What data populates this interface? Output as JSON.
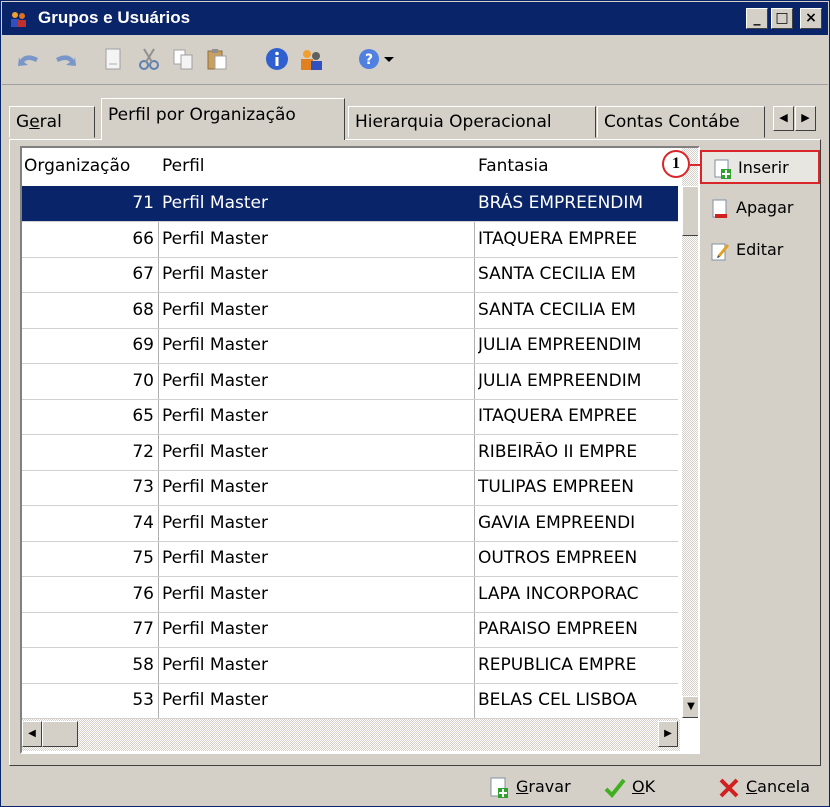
{
  "window": {
    "title": "Grupos e Usuários",
    "controls": {
      "minimize": "_",
      "maximize": "□",
      "close": "×"
    }
  },
  "toolbar": {
    "icons": [
      "undo-icon",
      "redo-icon",
      "new-document-icon",
      "cut-icon",
      "copy-icon",
      "paste-icon",
      "info-icon",
      "user-group-icon",
      "help-icon",
      "dropdown-arrow-icon"
    ]
  },
  "tabs": {
    "items": [
      {
        "label_pre": "G",
        "label_mnemonic": "e",
        "label_post": "ral",
        "active": false
      },
      {
        "label": "Perfil por Organização",
        "active": true
      },
      {
        "label": "Hierarquia Operacional",
        "active": false
      },
      {
        "label": "Contas Contábe",
        "active": false
      }
    ],
    "scroll_left": "◀",
    "scroll_right": "▶"
  },
  "grid": {
    "columns": [
      "Organização",
      "Perfil",
      "Fantasia"
    ],
    "rows": [
      {
        "org": "71",
        "perfil": "Perfil Master",
        "fantasia": "BRÁS EMPREENDIM",
        "selected": true
      },
      {
        "org": "66",
        "perfil": "Perfil Master",
        "fantasia": "ITAQUERA EMPREE",
        "selected": false
      },
      {
        "org": "67",
        "perfil": "Perfil Master",
        "fantasia": "SANTA CECILIA EM",
        "selected": false
      },
      {
        "org": "68",
        "perfil": "Perfil Master",
        "fantasia": "SANTA CECILIA EM",
        "selected": false
      },
      {
        "org": "69",
        "perfil": "Perfil Master",
        "fantasia": "JULIA EMPREENDIM",
        "selected": false
      },
      {
        "org": "70",
        "perfil": "Perfil Master",
        "fantasia": "JULIA EMPREENDIM",
        "selected": false
      },
      {
        "org": "65",
        "perfil": "Perfil Master",
        "fantasia": "ITAQUERA EMPREE",
        "selected": false
      },
      {
        "org": "72",
        "perfil": "Perfil Master",
        "fantasia": "RIBEIRÃO II EMPRE",
        "selected": false
      },
      {
        "org": "73",
        "perfil": "Perfil Master",
        "fantasia": "TULIPAS EMPREEN",
        "selected": false
      },
      {
        "org": "74",
        "perfil": "Perfil Master",
        "fantasia": "GAVIA EMPREENDI",
        "selected": false
      },
      {
        "org": "75",
        "perfil": "Perfil Master",
        "fantasia": "OUTROS EMPREEN",
        "selected": false
      },
      {
        "org": "76",
        "perfil": "Perfil Master",
        "fantasia": "LAPA INCORPORAC",
        "selected": false
      },
      {
        "org": "77",
        "perfil": "Perfil Master",
        "fantasia": "PARAISO EMPREEN",
        "selected": false
      },
      {
        "org": "58",
        "perfil": "Perfil Master",
        "fantasia": "REPUBLICA EMPRE",
        "selected": false
      },
      {
        "org": "53",
        "perfil": "Perfil Master",
        "fantasia": "BELAS CEL LISBOA",
        "selected": false
      }
    ]
  },
  "side_actions": {
    "insert": "Inserir",
    "delete": "Apagar",
    "edit": "Editar"
  },
  "callout": {
    "number": "1"
  },
  "footer": {
    "save_mnemonic": "G",
    "save_rest": "ravar",
    "ok_mnemonic": "O",
    "ok_rest": "K",
    "cancel_mnemonic": "C",
    "cancel_rest": "ancela"
  },
  "colors": {
    "titlebar": "#0a246a",
    "selection": "#0a246a",
    "highlight": "#d8262b",
    "face": "#d4d0c8"
  }
}
